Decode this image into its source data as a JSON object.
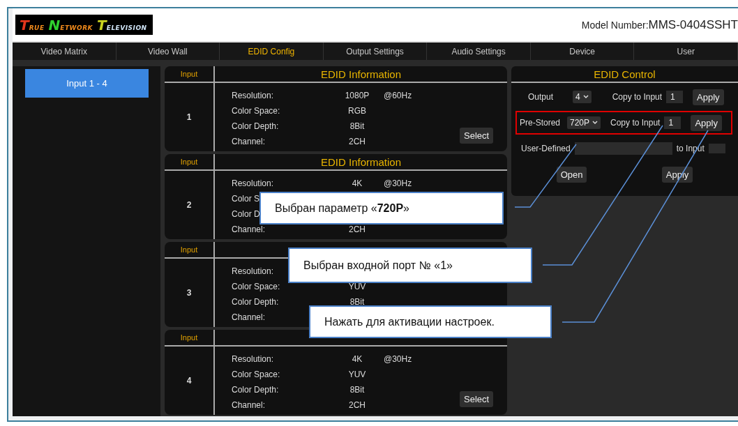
{
  "header": {
    "logo": [
      {
        "parts": [
          {
            "text": "T",
            "color": "#e4361c"
          },
          {
            "text": "RUE",
            "color": "#f08a1c"
          }
        ]
      },
      {
        "parts": [
          {
            "text": "N",
            "color": "#2fd02f"
          },
          {
            "text": "ETWORK",
            "color": "#f08a1c"
          }
        ]
      },
      {
        "parts": [
          {
            "text": "T",
            "color": "#c9d31f"
          },
          {
            "text": "ELEVISION",
            "color": "#cfe3f5"
          }
        ]
      }
    ],
    "model_label": "Model Number:",
    "model_value": "MMS-0404SSHT"
  },
  "tabs": [
    {
      "label": "Video Matrix",
      "selected": false
    },
    {
      "label": "Video Wall",
      "selected": false
    },
    {
      "label": "EDID Config",
      "selected": true
    },
    {
      "label": "Output Settings",
      "selected": false
    },
    {
      "label": "Audio Settings",
      "selected": false
    },
    {
      "label": "Device",
      "selected": false
    },
    {
      "label": "User",
      "selected": false
    }
  ],
  "sidebar": {
    "items": [
      {
        "label": "Input 1 - 4",
        "selected": true
      }
    ]
  },
  "inputs": [
    {
      "head": "Input",
      "title": "EDID Information",
      "number": "1",
      "rows": [
        {
          "label": "Resolution:",
          "value": "1080P",
          "extra": "@60Hz"
        },
        {
          "label": "Color Space:",
          "value": "RGB"
        },
        {
          "label": "Color Depth:",
          "value": "8Bit"
        },
        {
          "label": "Channel:",
          "value": "2CH"
        }
      ],
      "button": "Select"
    },
    {
      "head": "Input",
      "title": "EDID Information",
      "number": "2",
      "rows": [
        {
          "label": "Resolution:",
          "value": "4K",
          "extra": "@30Hz"
        },
        {
          "label": "Color S"
        },
        {
          "label": "Color D"
        },
        {
          "label": "Channel:",
          "value": "2CH"
        }
      ]
    },
    {
      "head": "Input",
      "number": "3",
      "rows": [
        {
          "label": "Resolution:"
        },
        {
          "label": "Color Space:",
          "value": "YUV"
        },
        {
          "label": "Color Depth:",
          "value": "8Bit"
        },
        {
          "label": "Channel:"
        }
      ]
    },
    {
      "head": "Input",
      "number": "4",
      "rows": [
        {
          "label": "Resolution:",
          "value": "4K",
          "extra": "@30Hz"
        },
        {
          "label": "Color Space:",
          "value": "YUV"
        },
        {
          "label": "Color Depth:",
          "value": "8Bit"
        },
        {
          "label": "Channel:",
          "value": "2CH"
        }
      ],
      "button": "Select"
    }
  ],
  "control": {
    "title": "EDID Control",
    "rows": [
      {
        "kind": "copy",
        "label": "Output",
        "select": "4",
        "copy_label": "Copy to Input",
        "input": "1",
        "button": "Apply",
        "highlighted": false
      },
      {
        "kind": "copy",
        "label": "Pre-Stored",
        "select": "720P",
        "copy_label": "Copy to Input",
        "input": "1",
        "button": "Apply",
        "highlighted": true
      },
      {
        "kind": "user",
        "label": "User-Defined",
        "to_label": "to Input"
      },
      {
        "kind": "buttons",
        "buttons": [
          "Open",
          "Apply"
        ]
      }
    ]
  },
  "callouts": [
    "Выбран параметр «**720P**»",
    "Выбран входной порт № «1»",
    "Нажать для активации настроек."
  ]
}
